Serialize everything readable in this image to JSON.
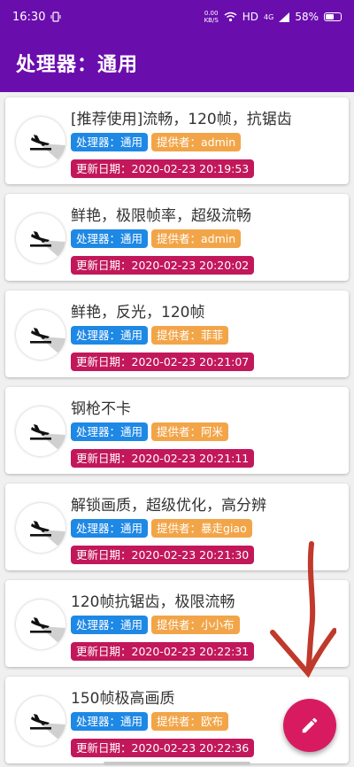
{
  "status_bar": {
    "time": "16:30",
    "net_speed_value": "0.00",
    "net_speed_unit": "KB/S",
    "hd": "HD",
    "network": "4G",
    "battery": "58%",
    "battery_level": 0.58
  },
  "app_bar": {
    "title": "处理器：通用"
  },
  "cards": [
    {
      "title": "[推荐使用]流畅，120帧，抗锯齿",
      "processor": "处理器：通用",
      "provider": "提供者：admin",
      "date": "更新日期：2020-02-23 20:19:53"
    },
    {
      "title": "鲜艳，极限帧率，超级流畅",
      "processor": "处理器：通用",
      "provider": "提供者：admin",
      "date": "更新日期：2020-02-23 20:20:02"
    },
    {
      "title": "鲜艳，反光，120帧",
      "processor": "处理器：通用",
      "provider": "提供者：菲菲",
      "date": "更新日期：2020-02-23 20:21:07"
    },
    {
      "title": "钢枪不卡",
      "processor": "处理器：通用",
      "provider": "提供者：阿米",
      "date": "更新日期：2020-02-23 20:21:11"
    },
    {
      "title": "解锁画质，超级优化，高分辨",
      "processor": "处理器：通用",
      "provider": "提供者：暴走giao",
      "date": "更新日期：2020-02-23 20:21:30"
    },
    {
      "title": "120帧抗锯齿，极限流畅",
      "processor": "处理器：通用",
      "provider": "提供者：小小布",
      "date": "更新日期：2020-02-23 20:22:31"
    },
    {
      "title": "150帧极高画质",
      "processor": "处理器：通用",
      "provider": "提供者：欧布",
      "date": "更新日期：2020-02-23 20:22:36"
    }
  ],
  "icons": {
    "card": "airplane-landing-icon",
    "fab": "edit-pencil-icon"
  },
  "colors": {
    "primary": "#6a0dad",
    "processor_tag": "#1e88e5",
    "provider_tag": "#f2a548",
    "date_tag": "#c2185b",
    "fab": "#d81b60",
    "annotation_arrow": "#c0392b"
  }
}
